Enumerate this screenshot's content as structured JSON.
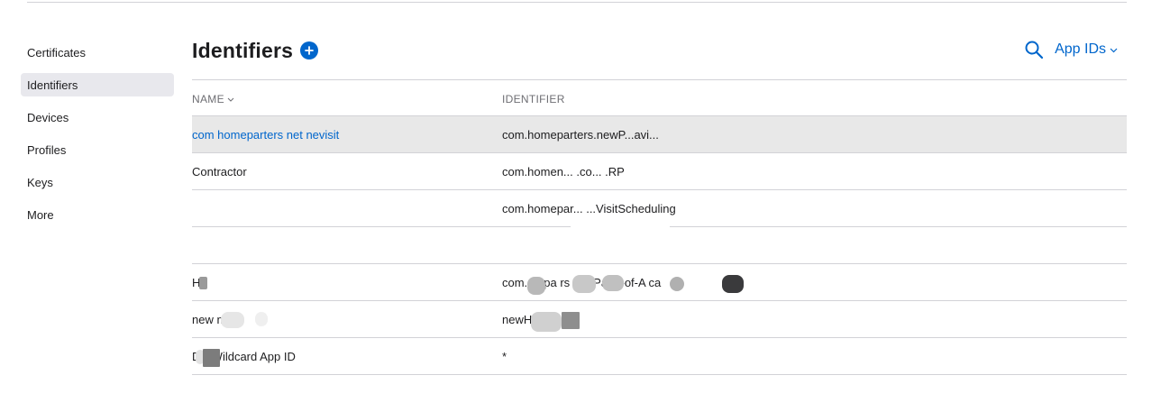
{
  "sidebar": {
    "items": [
      {
        "label": "Certificates"
      },
      {
        "label": "Identifiers"
      },
      {
        "label": "Devices"
      },
      {
        "label": "Profiles"
      },
      {
        "label": "Keys"
      },
      {
        "label": "More"
      }
    ],
    "active_index": 1
  },
  "header": {
    "title": "Identifiers",
    "add_icon": "plus-circle-icon",
    "search_icon": "magnifying-glass-icon",
    "filter_label": "App IDs"
  },
  "table": {
    "columns": {
      "name": "NAME",
      "identifier": "IDENTIFIER"
    },
    "rows": [
      {
        "name": "com homeparters net       nevisit",
        "identifier": "com.homeparters.newP...avi..."
      },
      {
        "name": "Contractor",
        "identifier": "com.homen...     .co...    .RP"
      },
      {
        "name": "",
        "identifier": "com.homepar...       ...VisitScheduling"
      },
      {
        "name": "",
        "identifier": ""
      },
      {
        "name": "H",
        "identifier": "com.   nepa     rs   me-Pa    rs-of-A    ca"
      },
      {
        "name": "new   me   .",
        "identifier": "newH"
      },
      {
        "name": "      DS Wildcard App ID",
        "identifier": "*"
      }
    ]
  },
  "colors": {
    "accent": "#0066cc",
    "selected_row": "#e8e8e8",
    "divider": "#d2d2d7"
  }
}
